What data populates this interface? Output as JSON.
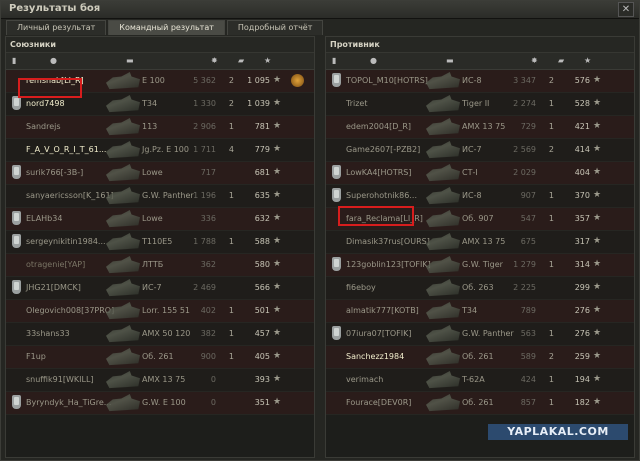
{
  "window": {
    "title": "Результаты боя",
    "close": "✕"
  },
  "tabs": [
    "Личный результат",
    "Командный результат",
    "Подробный отчёт"
  ],
  "allies": {
    "title": "Союзники",
    "rows": [
      {
        "player": "remsnab[LI_R]",
        "vehicle": "E 100",
        "n1": "5 362",
        "n2": "2",
        "n3": "1 095",
        "medal": false,
        "style": "me"
      },
      {
        "player": "nord7498",
        "vehicle": "T34",
        "n1": "1 330",
        "n2": "2",
        "n3": "1 039",
        "medal": true,
        "style": "me"
      },
      {
        "player": "Sandrejs",
        "vehicle": "113",
        "n1": "2 906",
        "n2": "1",
        "n3": "781",
        "medal": false,
        "style": "normal"
      },
      {
        "player": "F_A_V_O_R_I_T_61...",
        "vehicle": "Jg.Pz. E 100",
        "n1": "1 711",
        "n2": "4",
        "n3": "779",
        "medal": false,
        "style": "me"
      },
      {
        "player": "surik766[-3B-]",
        "vehicle": "Lowe",
        "n1": "717",
        "n2": "",
        "n3": "681",
        "medal": true,
        "style": "normal"
      },
      {
        "player": "sanyaericsson[K_161]",
        "vehicle": "G.W. Panther",
        "n1": "1 196",
        "n2": "1",
        "n3": "635",
        "medal": false,
        "style": "normal"
      },
      {
        "player": "ELAHb34",
        "vehicle": "Lowe",
        "n1": "336",
        "n2": "",
        "n3": "632",
        "medal": true,
        "style": "normal"
      },
      {
        "player": "sergeynikitin1984...",
        "vehicle": "T110E5",
        "n1": "1 788",
        "n2": "1",
        "n3": "588",
        "medal": true,
        "style": "normal"
      },
      {
        "player": "otragenie[YAP]",
        "vehicle": "ЛТТБ",
        "n1": "362",
        "n2": "",
        "n3": "580",
        "medal": false,
        "style": "dim"
      },
      {
        "player": "JHG21[DMCK]",
        "vehicle": "ИС-7",
        "n1": "2 469",
        "n2": "",
        "n3": "566",
        "medal": true,
        "style": "normal"
      },
      {
        "player": "Olegovich008[37PRO]",
        "vehicle": "Lorr. 155 51",
        "n1": "402",
        "n2": "1",
        "n3": "501",
        "medal": false,
        "style": "normal"
      },
      {
        "player": "33shans33",
        "vehicle": "AMX 50 120",
        "n1": "382",
        "n2": "1",
        "n3": "457",
        "medal": false,
        "style": "normal"
      },
      {
        "player": "F1up",
        "vehicle": "Об. 261",
        "n1": "900",
        "n2": "1",
        "n3": "405",
        "medal": false,
        "style": "normal"
      },
      {
        "player": "snuffik91[WKILL]",
        "vehicle": "AMX 13 75",
        "n1": "0",
        "n2": "",
        "n3": "393",
        "medal": false,
        "style": "normal"
      },
      {
        "player": "Byryndyk_Ha_TiGre...",
        "vehicle": "G.W. E 100",
        "n1": "0",
        "n2": "",
        "n3": "351",
        "medal": true,
        "style": "normal"
      }
    ]
  },
  "enemies": {
    "title": "Противник",
    "rows": [
      {
        "player": "TOPOL_M10[HOTRS]",
        "vehicle": "ИС-8",
        "n1": "3 347",
        "n2": "2",
        "n3": "576",
        "medal": true,
        "style": "normal"
      },
      {
        "player": "Trizet",
        "vehicle": "Tiger II",
        "n1": "2 274",
        "n2": "1",
        "n3": "528",
        "medal": false,
        "style": "normal"
      },
      {
        "player": "edem2004[D_R]",
        "vehicle": "AMX 13 75",
        "n1": "729",
        "n2": "1",
        "n3": "421",
        "medal": false,
        "style": "normal"
      },
      {
        "player": "Game2607[-PZB2]",
        "vehicle": "ИС-7",
        "n1": "2 569",
        "n2": "2",
        "n3": "414",
        "medal": false,
        "style": "normal"
      },
      {
        "player": "LowKA4[HOTRS]",
        "vehicle": "СТ-I",
        "n1": "2 029",
        "n2": "",
        "n3": "404",
        "medal": true,
        "style": "normal"
      },
      {
        "player": "Superohotnik86...",
        "vehicle": "ИС-8",
        "n1": "907",
        "n2": "1",
        "n3": "370",
        "medal": true,
        "style": "normal"
      },
      {
        "player": "fara_Reclama[LI_R]",
        "vehicle": "Об. 907",
        "n1": "547",
        "n2": "1",
        "n3": "357",
        "medal": false,
        "style": "normal"
      },
      {
        "player": "Dimasik37rus[OURS]",
        "vehicle": "AMX 13 75",
        "n1": "675",
        "n2": "",
        "n3": "317",
        "medal": false,
        "style": "normal"
      },
      {
        "player": "123goblin123[TOFIK]",
        "vehicle": "G.W. Tiger",
        "n1": "1 279",
        "n2": "1",
        "n3": "314",
        "medal": true,
        "style": "normal"
      },
      {
        "player": "fi6eboy",
        "vehicle": "Об. 263",
        "n1": "2 225",
        "n2": "",
        "n3": "299",
        "medal": false,
        "style": "normal"
      },
      {
        "player": "almatik777[KOTB]",
        "vehicle": "T34",
        "n1": "789",
        "n2": "",
        "n3": "276",
        "medal": false,
        "style": "normal"
      },
      {
        "player": "07iura07[TOFIK]",
        "vehicle": "G.W. Panther",
        "n1": "563",
        "n2": "1",
        "n3": "276",
        "medal": true,
        "style": "normal"
      },
      {
        "player": "Sanchezz1984",
        "vehicle": "Об. 261",
        "n1": "589",
        "n2": "2",
        "n3": "259",
        "medal": false,
        "style": "me"
      },
      {
        "player": "verimach",
        "vehicle": "T-62A",
        "n1": "424",
        "n2": "1",
        "n3": "194",
        "medal": false,
        "style": "normal"
      },
      {
        "player": "Fourace[DEV0R]",
        "vehicle": "Об. 261",
        "n1": "857",
        "n2": "1",
        "n3": "182",
        "medal": false,
        "style": "normal"
      }
    ]
  },
  "watermark": "YAPLAKAL.COM",
  "icons": {
    "star": "★",
    "column_icons": [
      "medal-icon",
      "player-icon",
      "tank-icon",
      "damage-icon",
      "kills-icon",
      "xp-icon"
    ]
  },
  "colors": {
    "highlight": "#d81d1d",
    "watermark_bg": "#2c4a6e"
  }
}
